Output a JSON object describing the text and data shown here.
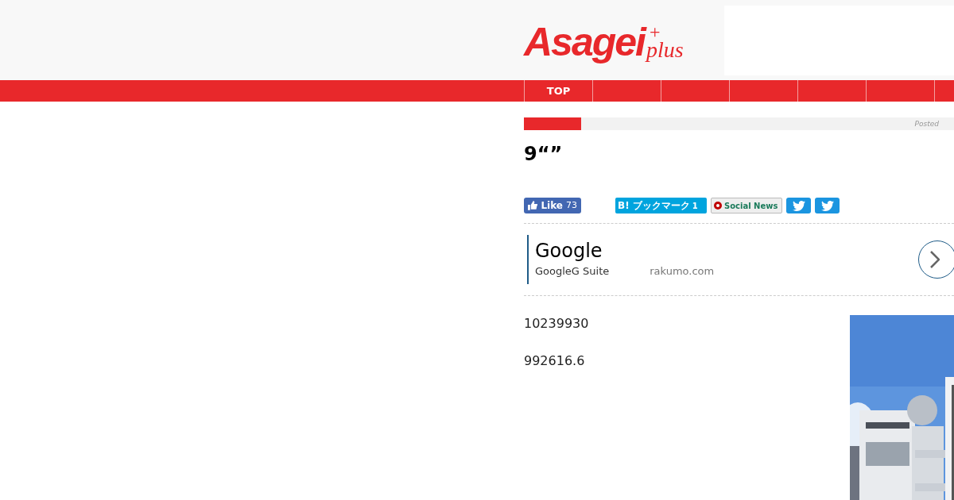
{
  "header": {
    "logo": {
      "main": "Asagei",
      "mark": "+",
      "suffix": "plus"
    }
  },
  "nav": [
    {
      "label": "TOP",
      "selected": false
    }
  ],
  "category_bar": {
    "posted": "Posted"
  },
  "article": {
    "title": "9“”",
    "share": [
      {
        "kind": "like",
        "label": "Like",
        "count": "73"
      },
      {
        "kind": "hatena",
        "label": "B! ブックマーク",
        "count": "1"
      },
      {
        "kind": "social",
        "label": "Social News"
      },
      {
        "kind": "tweet"
      },
      {
        "kind": "tweet"
      }
    ],
    "ad": {
      "title": "Google",
      "text": "GoogleG Suite",
      "domain": "rakumo.com"
    },
    "paragraphs": [
      "10239930",
      "992616.6"
    ]
  }
}
